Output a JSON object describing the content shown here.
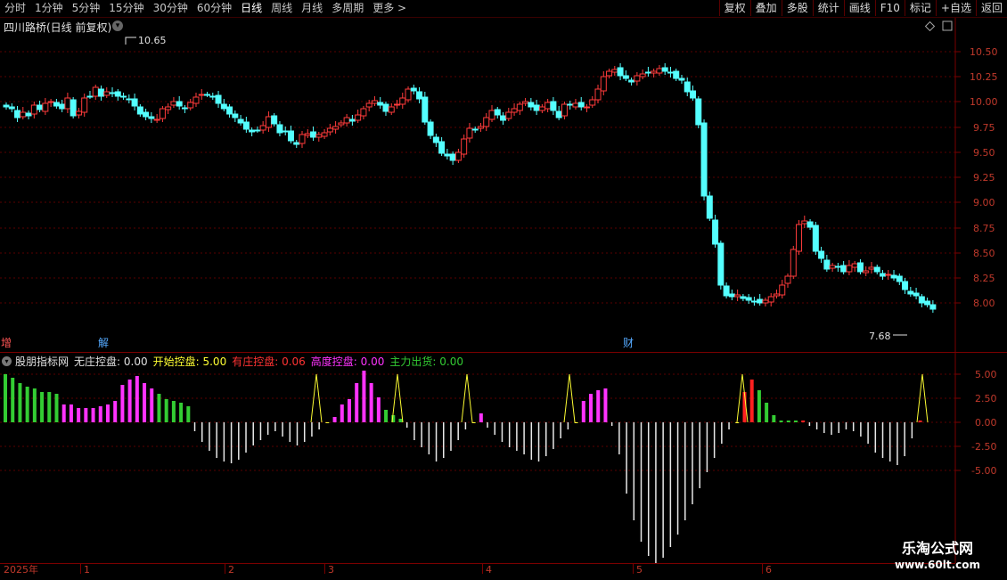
{
  "toolbar": {
    "periods": [
      "分时",
      "1分钟",
      "5分钟",
      "15分钟",
      "30分钟",
      "60分钟",
      "日线",
      "周线",
      "月线",
      "多周期",
      "更多 >"
    ],
    "active_period": "日线",
    "buttons": [
      "复权",
      "叠加",
      "多股",
      "统计",
      "画线",
      "F10",
      "标记",
      "+自选",
      "返回"
    ]
  },
  "main": {
    "title": "四川路桥(日线 前复权)",
    "price_ticks": [
      "10.50",
      "10.25",
      "10.00",
      "9.75",
      "9.50",
      "9.25",
      "9.00",
      "8.75",
      "8.50",
      "8.25",
      "8.00"
    ],
    "high_label": "10.65",
    "low_label": "7.68",
    "events": [
      {
        "label": "增",
        "color": "#ff5555"
      },
      {
        "label": "解",
        "color": "#55aaff"
      },
      {
        "label": "财",
        "color": "#55aaff"
      }
    ]
  },
  "indicator": {
    "name": "股朋指标网",
    "legend": [
      {
        "label": "无庄控盘:",
        "value": "0.00",
        "color": "#e0e0e0"
      },
      {
        "label": "开始控盘:",
        "value": "5.00",
        "color": "#ffff33"
      },
      {
        "label": "有庄控盘:",
        "value": "0.06",
        "color": "#ff3333"
      },
      {
        "label": "高度控盘:",
        "value": "0.00",
        "color": "#ff33ff"
      },
      {
        "label": "主力出货:",
        "value": "0.00",
        "color": "#33cc33"
      }
    ],
    "ticks": [
      "5.00",
      "2.50",
      "0.00",
      "-2.50",
      "-5.00"
    ]
  },
  "dates": {
    "labels": [
      "2025年",
      "1",
      "2",
      "3",
      "4",
      "5",
      "6"
    ]
  },
  "watermark": {
    "title": "乐淘公式网",
    "url": "www.60lt.com"
  },
  "colors": {
    "up": "#ff3b3b",
    "down": "#54ffff",
    "grid": "#5a0000",
    "axis": "#c0392b"
  }
}
